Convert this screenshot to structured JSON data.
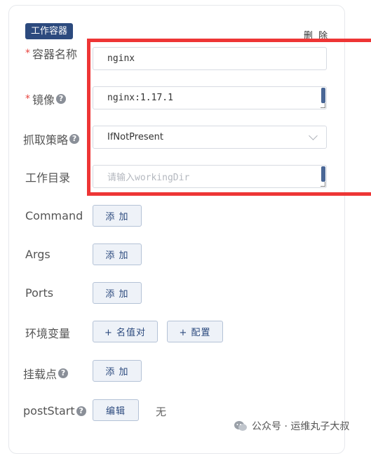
{
  "section_tag": "工作容器",
  "delete_label": "删 除",
  "fields": {
    "container_name": {
      "label": "容器名称",
      "required_mark": "*",
      "value": "nginx"
    },
    "image": {
      "label": "镜像",
      "required_mark": "*",
      "help": "?",
      "value": "nginx:1.17.1"
    },
    "pull_policy": {
      "label": "抓取策略",
      "help": "?",
      "value": "IfNotPresent"
    },
    "working_dir": {
      "label": "工作目录",
      "placeholder": "请输入workingDir"
    },
    "command": {
      "label": "Command",
      "button": "添 加"
    },
    "args": {
      "label": "Args",
      "button": "添 加"
    },
    "ports": {
      "label": "Ports",
      "button": "添 加"
    },
    "env": {
      "label": "环境变量",
      "button_kv": "+ 名值对",
      "button_config": "+ 配置"
    },
    "mounts": {
      "label": "挂载点",
      "help": "?",
      "button": "添 加"
    },
    "post_start": {
      "label": "postStart",
      "help": "?",
      "button": "编辑",
      "value": "无"
    }
  },
  "watermark": "公众号 · 运维丸子大叔",
  "colors": {
    "accent": "#2c4a7e",
    "highlight": "#ee3535",
    "required": "#e8443e"
  }
}
